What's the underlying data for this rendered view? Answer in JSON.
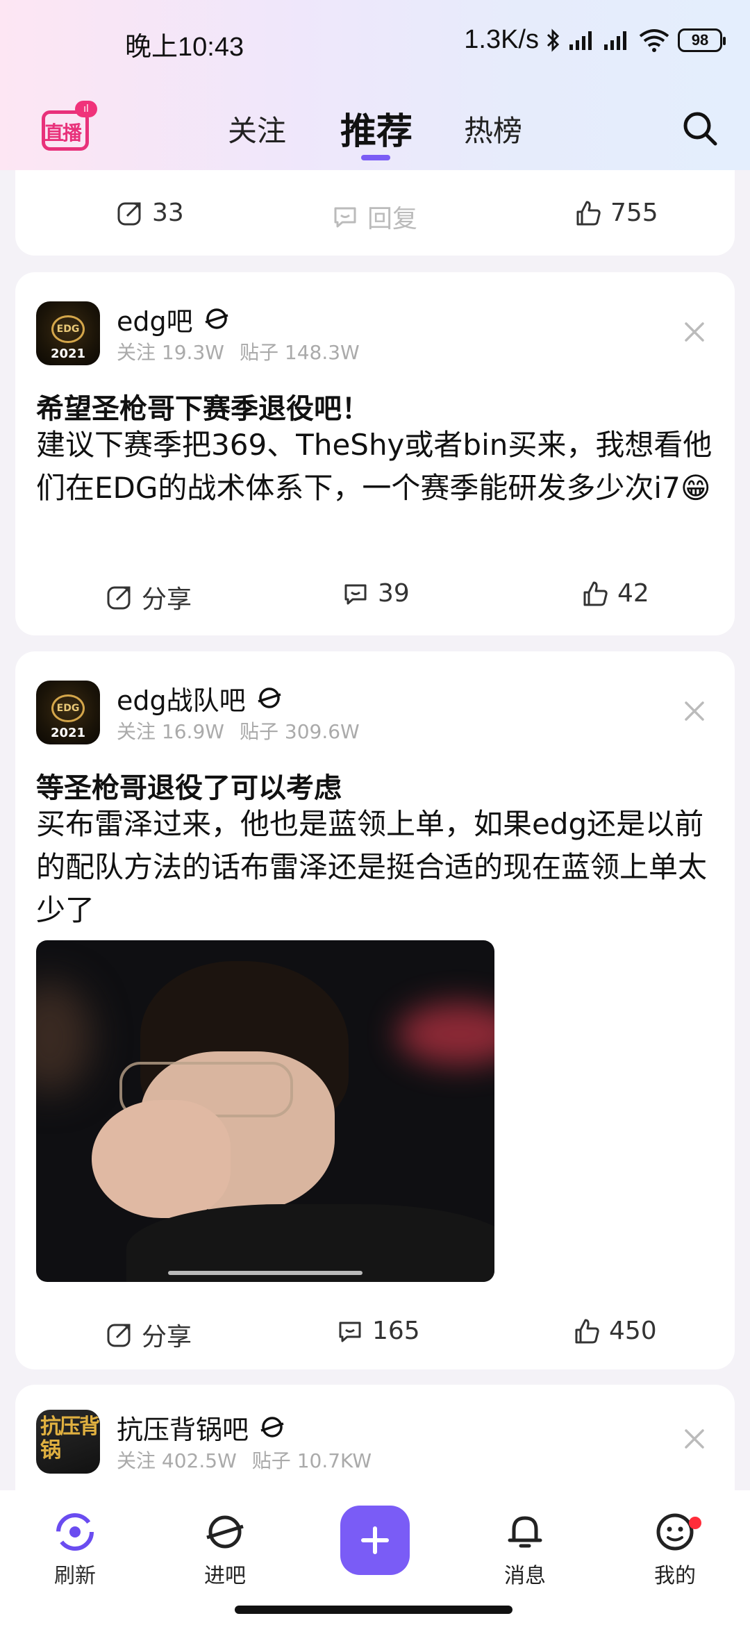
{
  "status_bar": {
    "time": "晚上10:43",
    "speed": "1.3K/s",
    "battery": "98"
  },
  "nav": {
    "live_logo_text": "直播",
    "tabs": [
      {
        "label": "关注"
      },
      {
        "label": "推荐"
      },
      {
        "label": "热榜"
      }
    ],
    "active_tab": "推荐"
  },
  "top_card": {
    "share_count": "33",
    "reply_label": "回复",
    "like_count": "755"
  },
  "posts": [
    {
      "forum": "edg吧",
      "avatar_year": "2021",
      "avatar_text": "EDG",
      "follow_label": "关注",
      "follow_count": "19.3W",
      "posts_label": "贴子",
      "posts_count": "148.3W",
      "title": "希望圣枪哥下赛季退役吧！",
      "body": "建议下赛季把369、TheShy或者bin买来，我想看他们在EDG的战术体系下，一个赛季能研发多少次i7😁",
      "share_label": "分享",
      "comment_count": "39",
      "like_count": "42"
    },
    {
      "forum": "edg战队吧",
      "avatar_year": "2021",
      "avatar_text": "EDG",
      "follow_label": "关注",
      "follow_count": "16.9W",
      "posts_label": "贴子",
      "posts_count": "309.6W",
      "title": "等圣枪哥退役了可以考虑",
      "body": "买布雷泽过来，他也是蓝领上单，如果edg还是以前的配队方法的话布雷泽还是挺合适的现在蓝领上单太少了",
      "share_label": "分享",
      "comment_count": "165",
      "like_count": "450"
    },
    {
      "forum": "抗压背锅吧",
      "avatar_text": "抗压背锅",
      "follow_label": "关注",
      "follow_count": "402.5W",
      "posts_label": "贴子",
      "posts_count": "10.7KW"
    }
  ],
  "bottom_nav": [
    {
      "label": "刷新",
      "icon": "refresh-icon"
    },
    {
      "label": "进吧",
      "icon": "planet-icon"
    },
    {
      "label": "",
      "icon": "plus-icon"
    },
    {
      "label": "消息",
      "icon": "bell-icon"
    },
    {
      "label": "我的",
      "icon": "smiley-icon"
    }
  ],
  "colors": {
    "accent": "#7a5cf6",
    "live": "#e8317a",
    "badge_red": "#ff2d3a"
  }
}
